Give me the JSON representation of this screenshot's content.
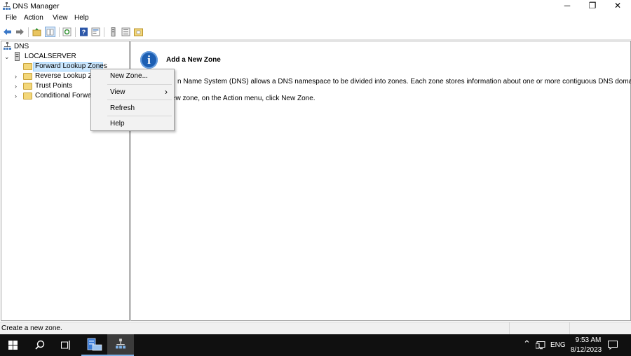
{
  "window": {
    "title": "DNS Manager",
    "minimize": "─",
    "restore": "❐",
    "close": "✕"
  },
  "menubar": [
    "File",
    "Action",
    "View",
    "Help"
  ],
  "tree": {
    "root": "DNS",
    "server": "LOCALSERVER",
    "items": [
      {
        "label": "Forward Lookup Zones"
      },
      {
        "label": "Reverse Lookup Zo"
      },
      {
        "label": "Trust Points"
      },
      {
        "label": "Conditional Forwar"
      }
    ]
  },
  "detail": {
    "heading": "Add a New Zone",
    "line1": "n Name System (DNS) allows a DNS namespace to be divided into zones. Each zone stores information about one or more contiguous DNS domains.",
    "line2": "ew zone, on the Action menu, click New Zone."
  },
  "context_menu": {
    "items": [
      "New Zone...",
      "View",
      "Refresh",
      "Help"
    ],
    "submenu_arrow": "›"
  },
  "status": {
    "text": "Create a new zone."
  },
  "taskbar": {
    "time": "9:53 AM",
    "date": "8/12/2023",
    "lang": "ENG"
  },
  "colors": {
    "selection": "#cce8ff",
    "taskbar": "#101010",
    "info": "#1d5fb3"
  }
}
